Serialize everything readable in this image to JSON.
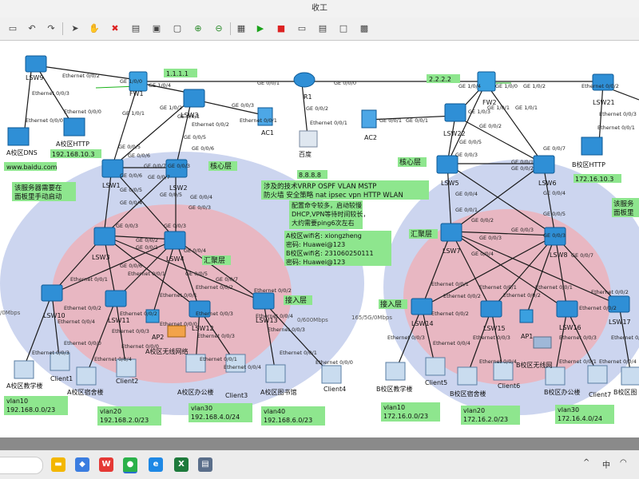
{
  "window": {
    "title": "收工"
  },
  "labels": {
    "lsw9": "LSW9",
    "fw1": "FW1",
    "r1": "R1",
    "fw2": "FW2",
    "lsw21": "LSW21",
    "lsw1": "LSW1",
    "lsw2": "LSW2",
    "lsw3": "LSW3",
    "lsw4": "LSW4",
    "lsw5": "LSW5",
    "lsw6": "LSW6",
    "lsw7": "LSW7",
    "lsw8": "LSW8",
    "lsw22": "LSW22",
    "lsw10": "LSW10",
    "lsw11": "LSW11",
    "lsw12": "LSW12",
    "lsw13": "LSW13",
    "lsw14": "LSW14",
    "lsw15": "LSW15",
    "lsw16": "LSW16",
    "lsw17": "LSW17",
    "ac1": "AC1",
    "ac2": "AC2",
    "ap1": "AP1",
    "ap2": "AP2",
    "baidu": "百度",
    "a_dns": "A校区DNS",
    "a_http": "A校区HTTP",
    "b_http": "B校区HTTP",
    "a_teach": "A校区教学楼",
    "a_dorm": "A校区宿舍楼",
    "a_wifi": "A校区无线网络",
    "a_office": "A校区办公楼",
    "a_lib": "A校区图书馆",
    "b_teach": "B校区教学楼",
    "b_dorm": "B校区宿舍楼",
    "b_wifi": "B校区无线网",
    "b_office": "B校区办公楼",
    "b_lib": "B校区图",
    "client1": "Client1",
    "client2": "Client2",
    "client3": "Client3",
    "client4": "Client4",
    "client5": "Client5",
    "client6": "Client6",
    "client7": "Client7",
    "core_a": "核心层",
    "core_b": "核心层",
    "agg_a": "汇聚层",
    "agg_b": "汇聚层",
    "acc_a": "接入层",
    "acc_b": "接入层",
    "speed_a": "/0Mbps",
    "speed_mid": "0/600Mbps",
    "speed_b": "165/5G/0Mbps",
    "lsw3_dup": "LSW3",
    "ap1_dup": "AP1"
  },
  "ports": {
    "e002": "Ethernet 0/0/2",
    "e003": "Ethernet 0/0/3",
    "e000": "Ethernet 0/0/0",
    "e001": "Ethernet 0/0/1",
    "e004": "Ethernet 0/0/4",
    "e005": "Ethernet 0/0/5",
    "ge101": "GE 1/0/1",
    "ge102": "GE 1/0/2",
    "ge104": "GE 1/0/4",
    "ge103": "GE 1/0/3",
    "ge100": "GE 1/0/0",
    "ge000": "GE 0/0/0",
    "ge001": "GE 0/0/1",
    "ge002": "GE 0/0/2",
    "ge003": "GE 0/0/3",
    "ge004": "GE 0/0/4",
    "ge005": "GE 0/0/5",
    "ge006": "GE 0/0/6",
    "ge007": "GE 0/0/7",
    "ge0_3": "GE 0/0/3",
    "ge00_5": "GE 0/0/5",
    "ge_7": "GE 0/0/7"
  },
  "tags": {
    "ip_a_http": "192.168.10.3",
    "dns_name": "www.baidu.com",
    "ip_1111": "1.1.1.1",
    "ip_2222": "2.2.2.2",
    "ip_8888": "8.8.8.8",
    "ip_b_http": "172.16.10.3",
    "vlan10": "vlan10",
    "vlan20": "vlan20",
    "vlan30": "vlan30",
    "vlan40": "vlan40",
    "net_a10": "192.168.0.0/23",
    "net_a20": "192.168.2.0/23",
    "net_a30": "192.168.4.0/24",
    "net_a40": "192.168.6.0/23",
    "net_b10": "172.16.0.0/23",
    "net_b20": "172.16.2.0/23",
    "net_b30": "172.16.4.0/24"
  },
  "notes": {
    "service_a1": "该服务器需要在",
    "service_a2": "面板里手动启动",
    "service_b1": "该服务",
    "service_b2": "面板里",
    "tech1": "涉及的技术VRRP OSPF VLAN MSTP",
    "tech2": "防火墙 安全策略 nat ipsec vpn HTTP WLAN",
    "tip1": "配置命令较多，启动较慢",
    "tip2": "DHCP,VPN等待时间较长，",
    "tip3": "大约需要ping6次左右",
    "wifi1": "A校区wifi名: xiongzheng",
    "wifi2": "密码: Huawei@123",
    "wifi3": "B校区wifi名: 231060250111",
    "wifi4": "密码: Huawei@123"
  },
  "taskbar": {
    "ime": "中",
    "apps": [
      "files",
      "copilot",
      "wps",
      "wechat",
      "edge",
      "excel",
      "tool"
    ]
  },
  "colors": {
    "tag": "#8ee68e",
    "halo": "#ccd5ef",
    "inner": "#e8b7c2",
    "device": "#2f8fd6",
    "line": "#1a1a1a",
    "green_line": "#19b319"
  }
}
